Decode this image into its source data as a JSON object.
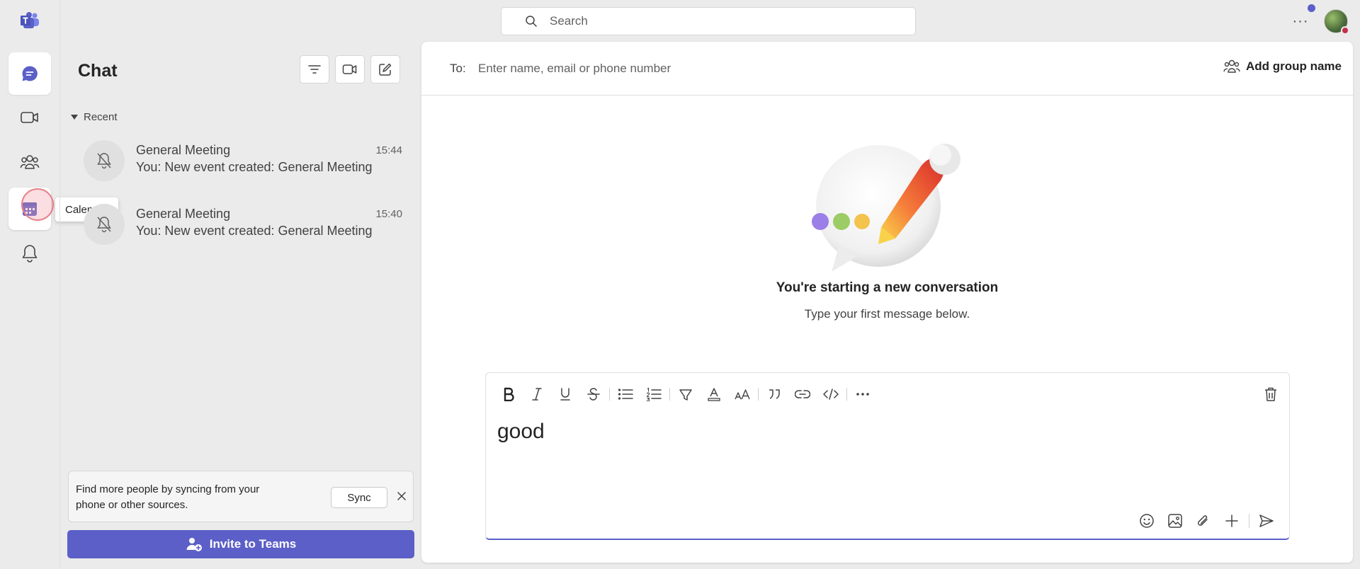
{
  "search": {
    "placeholder": "Search"
  },
  "rail": {
    "items": [
      {
        "name": "chat",
        "icon": "chat-icon",
        "active": true
      },
      {
        "name": "meet",
        "icon": "video-camera-icon"
      },
      {
        "name": "communities",
        "icon": "people-icon"
      },
      {
        "name": "calendar",
        "icon": "calendar-icon",
        "hovered": true
      },
      {
        "name": "activity",
        "icon": "bell-icon"
      }
    ],
    "tooltip": "Calendar"
  },
  "chat_panel": {
    "title": "Chat",
    "section_label": "Recent",
    "items": [
      {
        "name": "General Meeting",
        "preview": "You: New event created: General Meeting",
        "time": "15:44"
      },
      {
        "name": "General Meeting",
        "preview": "You: New event created: General Meeting",
        "time": "15:40"
      }
    ],
    "sync_card": {
      "text": "Find more people by syncing from your phone or other sources.",
      "button_label": "Sync"
    },
    "invite_label": "Invite to Teams"
  },
  "main": {
    "to_label": "To:",
    "to_placeholder": "Enter name, email or phone number",
    "add_group_label": "Add group name",
    "empty_title": "You're starting a new conversation",
    "empty_subtitle": "Type your first message below.",
    "composer_text": "good"
  },
  "colors": {
    "accent": "#5b5fc7",
    "background": "#ebebeb",
    "surface": "#ffffff"
  }
}
